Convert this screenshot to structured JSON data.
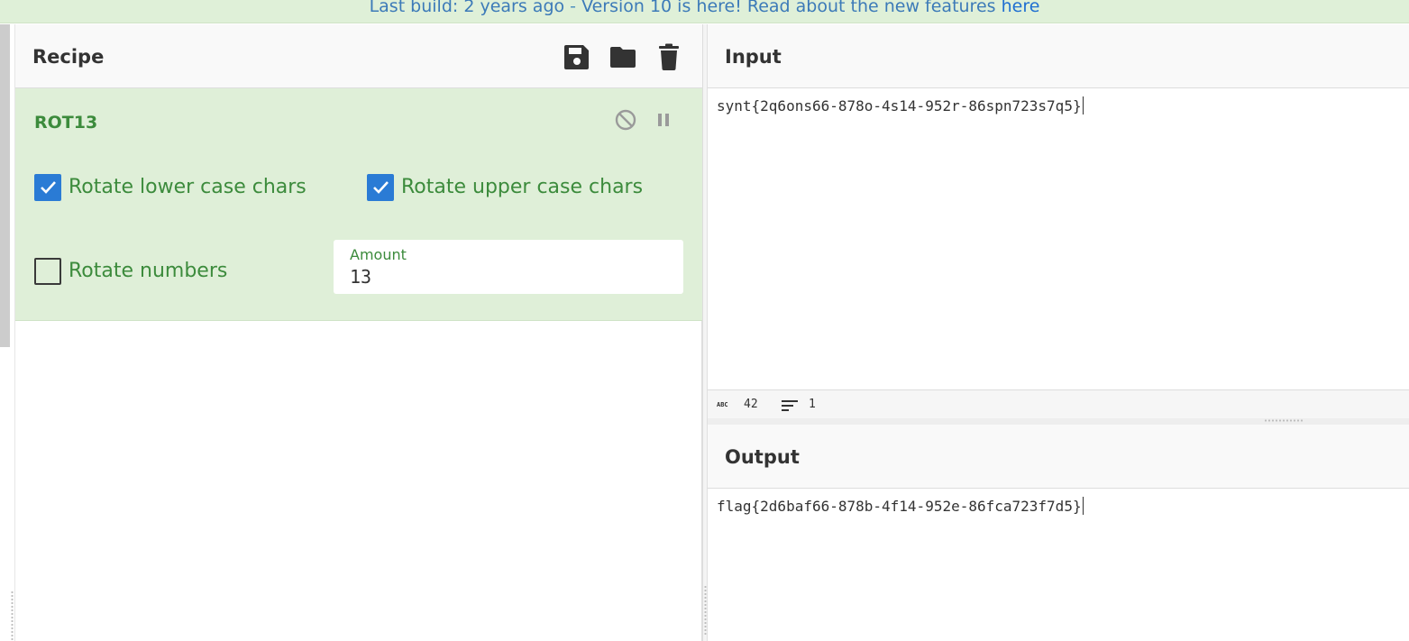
{
  "banner": {
    "prefix": "Last build: 2 years ago",
    "separator": " - ",
    "message": "Version 10 is here! Read about the new features ",
    "link": "here"
  },
  "recipe": {
    "title": "Recipe",
    "icons": [
      "save-icon",
      "folder-icon",
      "trash-icon"
    ],
    "operation": {
      "name": "ROT13",
      "icons": [
        "disable-icon",
        "pause-icon"
      ],
      "options": {
        "rotate_lower": {
          "label": "Rotate lower case chars",
          "checked": true
        },
        "rotate_upper": {
          "label": "Rotate upper case chars",
          "checked": true
        },
        "rotate_numbers": {
          "label": "Rotate numbers",
          "checked": false
        },
        "amount": {
          "label": "Amount",
          "value": "13"
        }
      }
    }
  },
  "input": {
    "title": "Input",
    "text": "synt{2q6ons66-878o-4s14-952r-86spn723s7q5}",
    "status": {
      "length": "42",
      "lines": "1"
    }
  },
  "output": {
    "title": "Output",
    "text": "flag{2d6baf66-878b-4f14-952e-86fca723f7d5}"
  },
  "colors": {
    "banner_bg": "#dff0d8",
    "operation_bg": "#dfefd8",
    "operation_text": "#3c8b3c",
    "checkbox_on": "#2a7bd5",
    "link": "#1f6fd1"
  }
}
